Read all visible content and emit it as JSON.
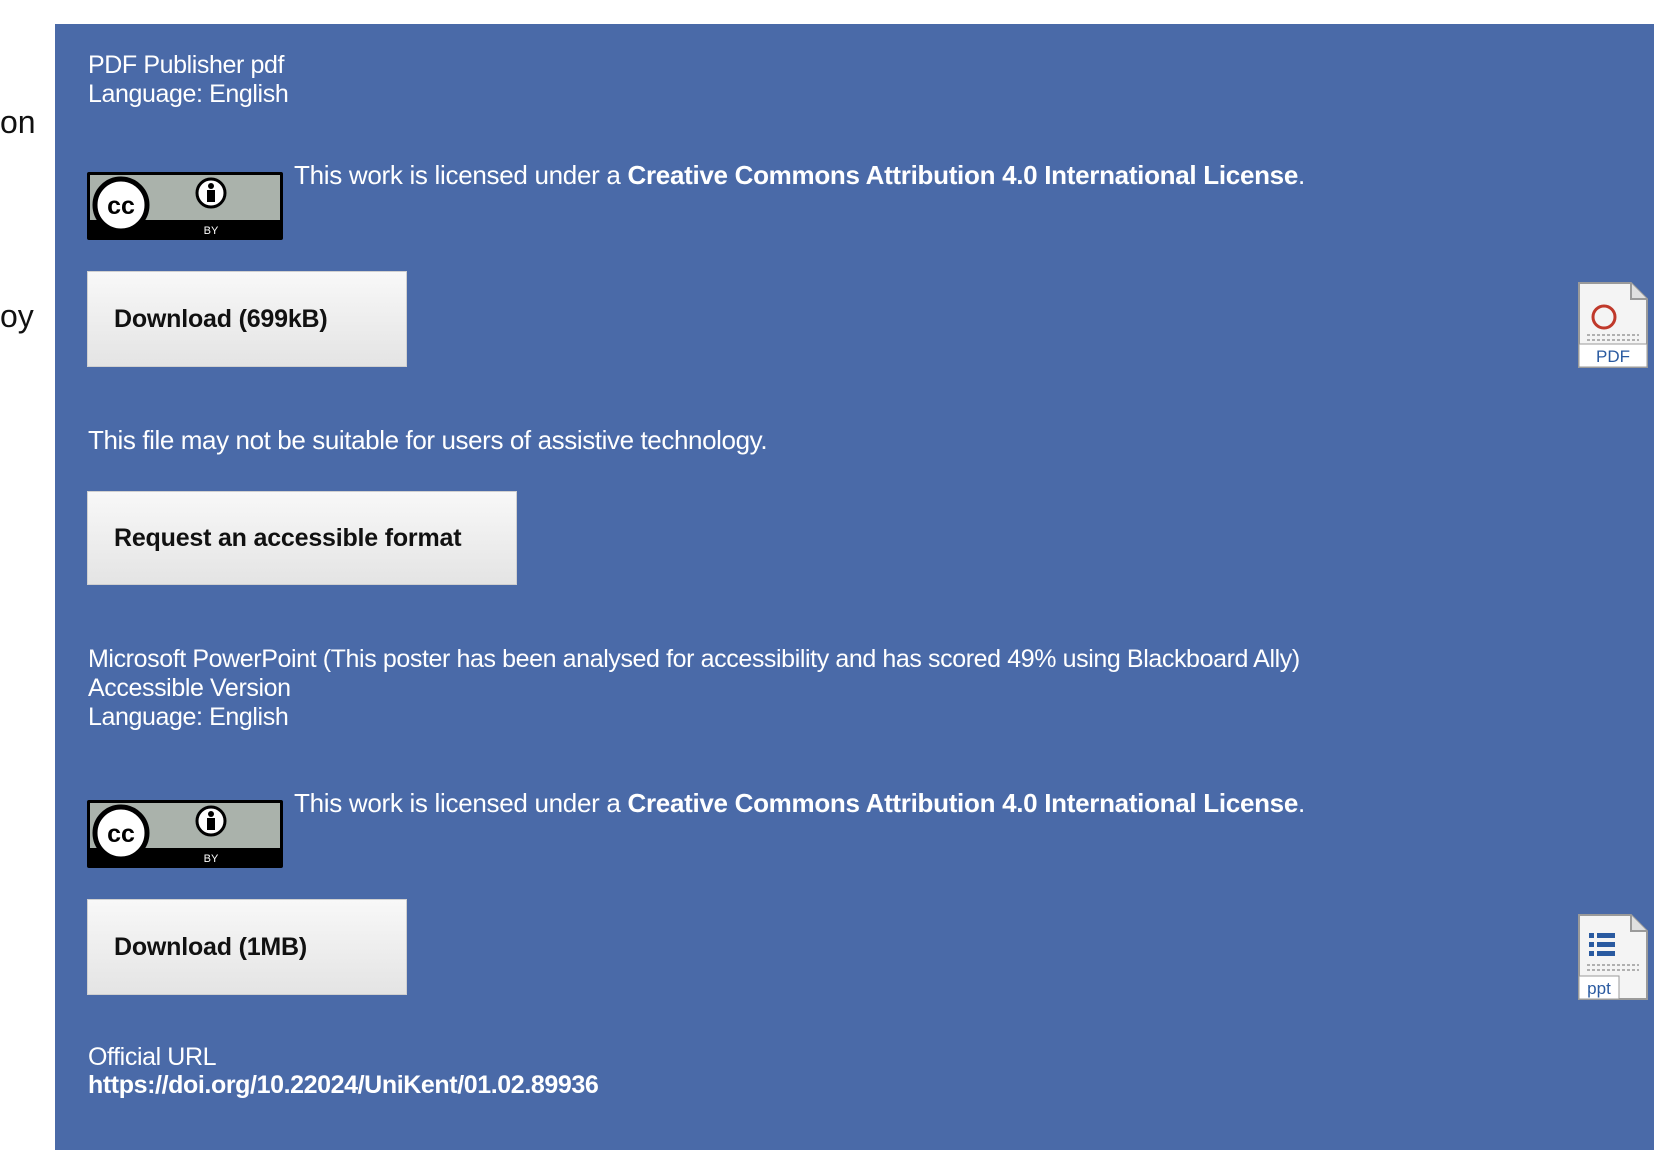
{
  "left_fragments": [
    "on",
    "oy"
  ],
  "items": [
    {
      "publisher_line": "PDF Publisher pdf",
      "language_line": "Language: English",
      "license": {
        "prefix": "This work is licensed under a ",
        "link": "Creative Commons Attribution 4.0 International License",
        "suffix": ".",
        "badge_cc": "cc",
        "badge_by": "BY"
      },
      "download_label": "Download (699kB)",
      "file_icon": "pdf-file-icon",
      "file_icon_label": "PDF"
    },
    {
      "format_line": "Microsoft PowerPoint (This poster has been analysed for accessibility and has scored 49% using Blackboard Ally)",
      "version_line": "Accessible Version",
      "language_line": "Language: English",
      "license": {
        "prefix": "This work is licensed under a ",
        "link": "Creative Commons Attribution 4.0 International License",
        "suffix": ".",
        "badge_cc": "cc",
        "badge_by": "BY"
      },
      "download_label": "Download (1MB)",
      "file_icon": "ppt-file-icon",
      "file_icon_label": "ppt"
    }
  ],
  "accessibility": {
    "notice": "This file may not be suitable for users of assistive technology.",
    "request_label": "Request an accessible format"
  },
  "official_url": {
    "label": "Official URL",
    "value": "https://doi.org/10.22024/UniKent/01.02.89936"
  },
  "colors": {
    "panel_bg": "#4a6aa8",
    "button_bg": "#f0f0f0",
    "pdf_red": "#c0392b",
    "ppt_blue": "#2a5aa0"
  }
}
